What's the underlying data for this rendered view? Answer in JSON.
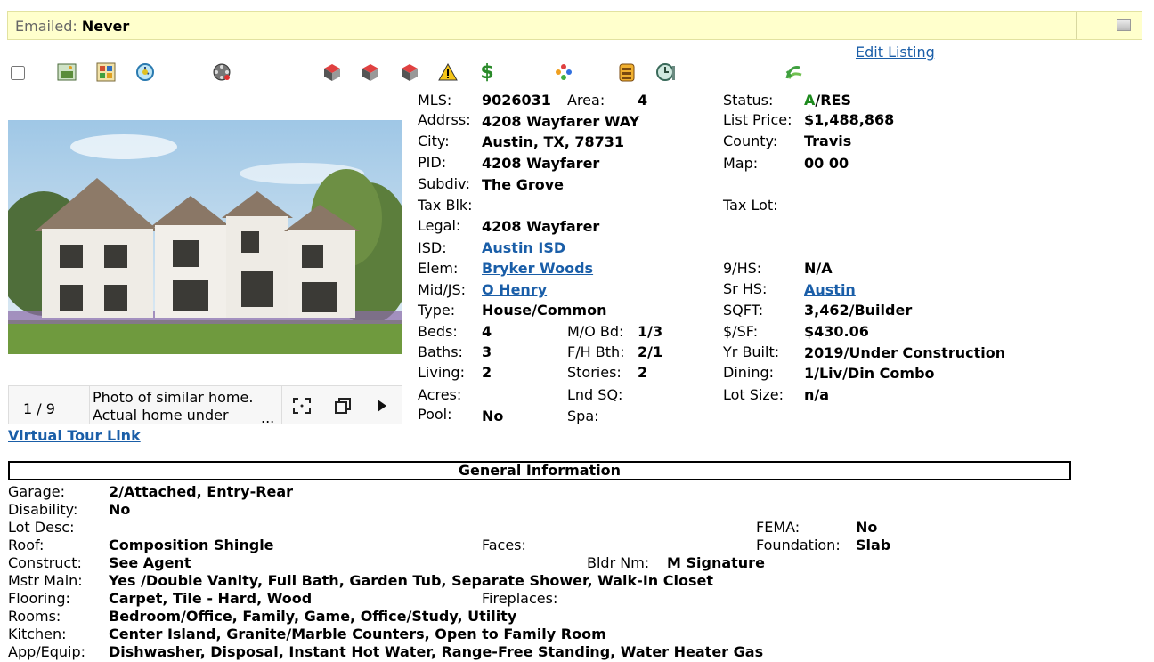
{
  "topbar": {
    "emailed_label": "Emailed:",
    "emailed_value": "Never"
  },
  "edit_listing": "Edit Listing",
  "icons": [
    "checkbox",
    "photo-edit-icon",
    "gallery-icon",
    "history-icon",
    "film-reel-icon",
    "cube-icon",
    "cube-icon",
    "cube-icon",
    "warning-icon",
    "dollar-icon",
    "pinwheel-icon",
    "building-icon",
    "clock-gear-icon",
    "leaf-icon"
  ],
  "gallery": {
    "counter": "1 / 9",
    "caption_line1": "Photo of similar home.",
    "caption_line2": "Actual home under",
    "ellipsis": "..."
  },
  "virtual_tour": "Virtual Tour Link",
  "listing": {
    "mls_label": "MLS:",
    "mls": "9026031",
    "area_label": "Area:",
    "area": "4",
    "status_label": "Status:",
    "status_a": "A",
    "status_rest": "/RES",
    "addr_label": "Addrss:",
    "addr": "4208 Wayfarer WAY",
    "listprice_label": "List Price:",
    "listprice": "$1,488,868",
    "city_label": "City:",
    "city": "Austin, TX, 78731",
    "county_label": "County:",
    "county": "Travis",
    "pid_label": "PID:",
    "pid": "4208 Wayfarer",
    "map_label": "Map:",
    "map": "00 00",
    "subdiv_label": "Subdiv:",
    "subdiv": "The Grove",
    "taxblk_label": "Tax Blk:",
    "taxlot_label": "Tax Lot:",
    "legal_label": "Legal:",
    "legal": "4208 Wayfarer",
    "isd_label": "ISD:",
    "isd": "Austin ISD",
    "elem_label": "Elem:",
    "elem": "Bryker Woods",
    "nhs_label": "9/HS:",
    "nhs": "N/A",
    "mid_label": "Mid/JS:",
    "mid": "O Henry",
    "srhs_label": "Sr HS:",
    "srhs": "Austin",
    "type_label": "Type:",
    "type": "House/Common",
    "sqft_label": "SQFT:",
    "sqft": "3,462/Builder",
    "beds_label": "Beds:",
    "beds": "4",
    "mobd_label": "M/O Bd:",
    "mobd": "1/3",
    "psf_label": "$/SF:",
    "psf": "$430.06",
    "baths_label": "Baths:",
    "baths": "3",
    "fhbth_label": "F/H Bth:",
    "fhbth": "2/1",
    "yrbuilt_label": "Yr Built:",
    "yrbuilt": "2019/Under Construction",
    "living_label": "Living:",
    "living": "2",
    "stories_label": "Stories:",
    "stories": "2",
    "dining_label": "Dining:",
    "dining": "1/Liv/Din Combo",
    "acres_label": "Acres:",
    "lndsq_label": "Lnd SQ:",
    "lotsize_label": "Lot Size:",
    "lotsize": "n/a",
    "pool_label": "Pool:",
    "pool": "No",
    "spa_label": "Spa:"
  },
  "general": {
    "title": "General Information",
    "garage_label": "Garage:",
    "garage": "2/Attached, Entry-Rear",
    "disability_label": "Disability:",
    "disability": "No",
    "lotdesc_label": "Lot Desc:",
    "fema_label": "FEMA:",
    "fema": "No",
    "roof_label": "Roof:",
    "roof": "Composition Shingle",
    "faces_label": "Faces:",
    "foundation_label": "Foundation:",
    "foundation": "Slab",
    "construct_label": "Construct:",
    "construct": "See Agent",
    "bldr_label": "Bldr Nm:",
    "bldr": "M Signature",
    "mstr_label": "Mstr Main:",
    "mstr": "Yes /Double Vanity, Full Bath, Garden Tub, Separate Shower, Walk-In Closet",
    "flooring_label": "Flooring:",
    "flooring": "Carpet, Tile - Hard, Wood",
    "fireplaces_label": "Fireplaces:",
    "rooms_label": "Rooms:",
    "rooms": "Bedroom/Office, Family, Game, Office/Study, Utility",
    "kitchen_label": "Kitchen:",
    "kitchen": "Center Island, Granite/Marble Counters, Open to Family Room",
    "appequip_label": "App/Equip:",
    "appequip": "Dishwasher, Disposal, Instant Hot Water, Range-Free Standing, Water Heater Gas"
  },
  "colors": {
    "link": "#1a5ea8",
    "status_active": "#1e8a1e",
    "banner": "#ffffcc"
  }
}
